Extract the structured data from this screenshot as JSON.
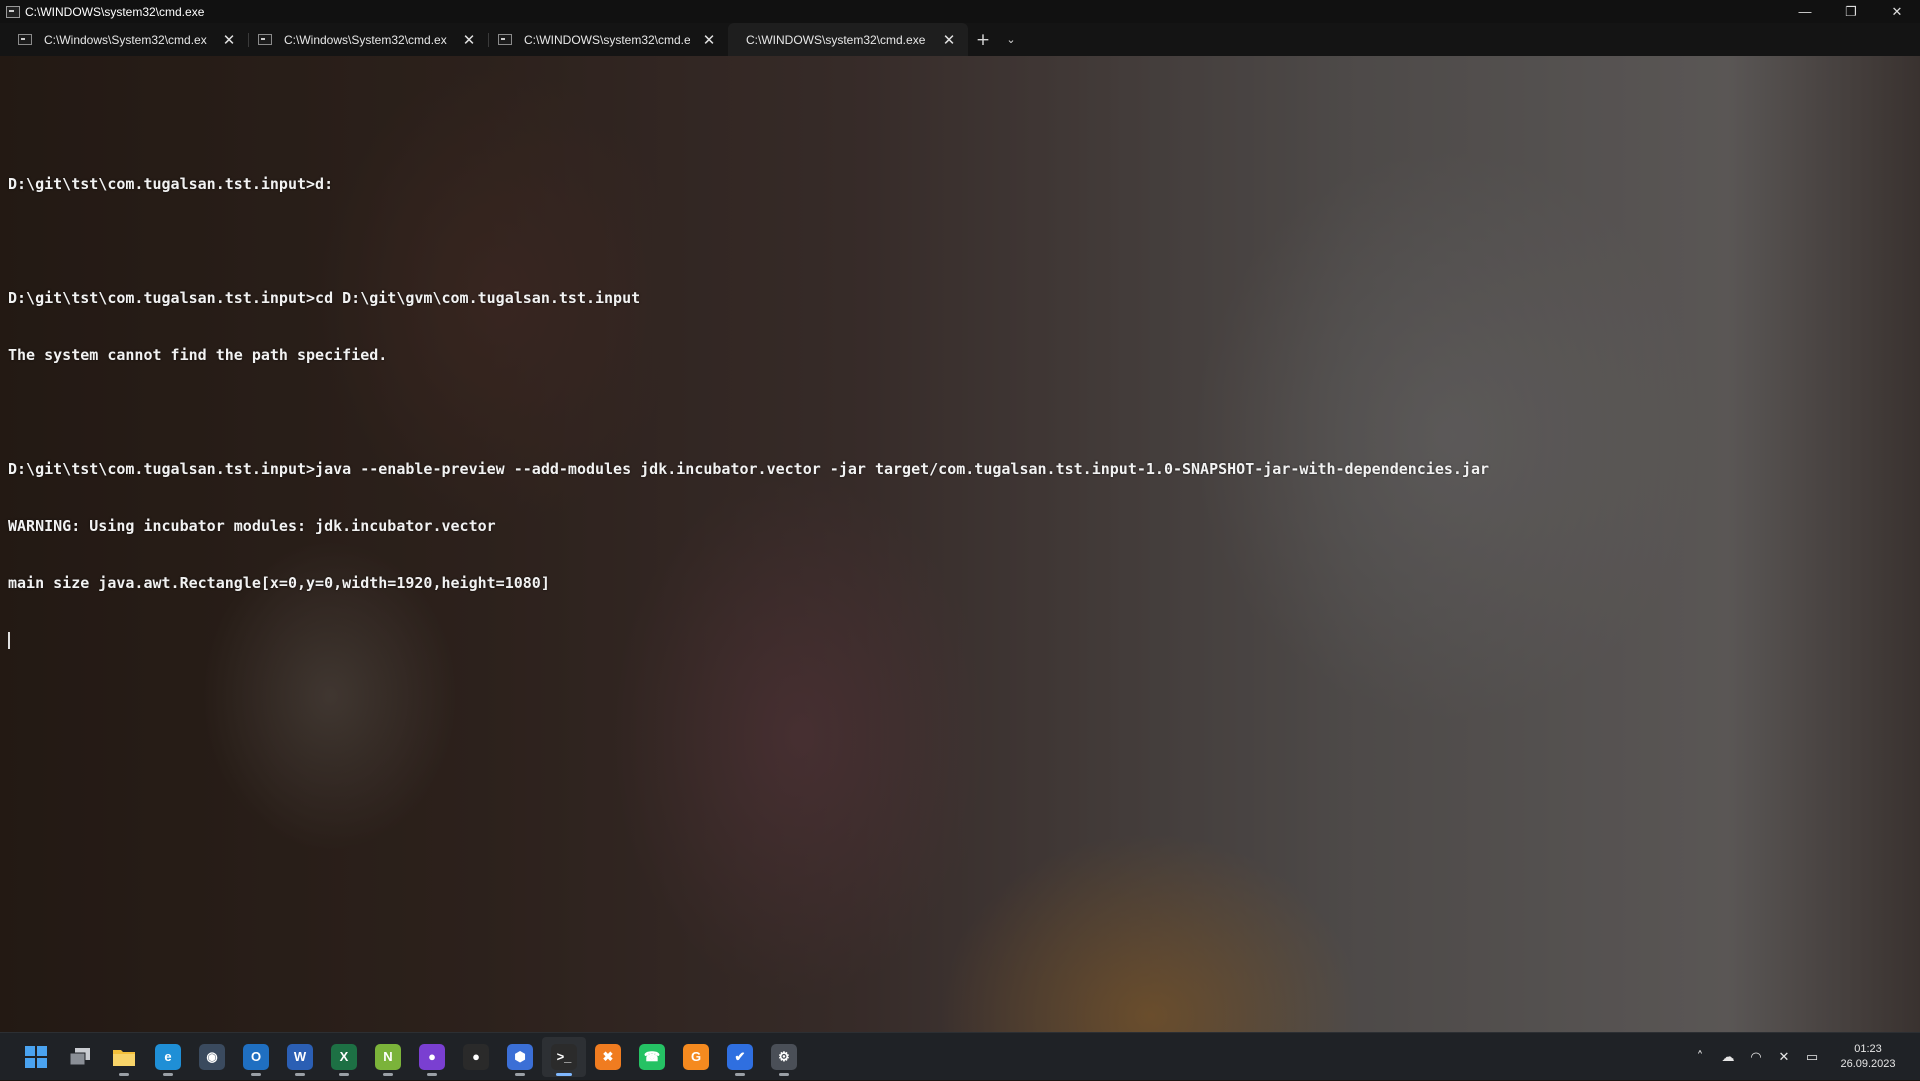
{
  "window": {
    "title": "C:\\WINDOWS\\system32\\cmd.exe",
    "controls": {
      "minimize": "—",
      "restore": "❐",
      "close": "✕"
    }
  },
  "tabs": [
    {
      "label": "C:\\Windows\\System32\\cmd.ex",
      "active": false
    },
    {
      "label": "C:\\Windows\\System32\\cmd.ex",
      "active": false
    },
    {
      "label": "C:\\WINDOWS\\system32\\cmd.е",
      "active": false
    },
    {
      "label": "C:\\WINDOWS\\system32\\cmd.exе",
      "active": true
    }
  ],
  "tab_controls": {
    "close": "✕",
    "add": "+",
    "dropdown": "⌄"
  },
  "terminal": {
    "lines": [
      "",
      "D:\\git\\tst\\com.tugalsan.tst.input>d:",
      "",
      "D:\\git\\tst\\com.tugalsan.tst.input>cd D:\\git\\gvm\\com.tugalsan.tst.input",
      "The system cannot find the path specified.",
      "",
      "D:\\git\\tst\\com.tugalsan.tst.input>java --enable-preview --add-modules jdk.incubator.vector -jar target/com.tugalsan.tst.input-1.0-SNAPSHOT-jar-with-dependencies.jar",
      "WARNING: Using incubator modules: jdk.incubator.vector",
      "main size java.awt.Rectangle[x=0,y=0,width=1920,height=1080]"
    ]
  },
  "taskbar": {
    "apps": [
      {
        "name": "start-icon",
        "glyph": "",
        "color": "#3b8eea",
        "running": false
      },
      {
        "name": "task-view-icon",
        "glyph": "",
        "color": "#8a8f96",
        "running": false
      },
      {
        "name": "file-explorer-icon",
        "glyph": "",
        "color": "#f3c03b",
        "running": true
      },
      {
        "name": "edge-icon",
        "glyph": "e",
        "color": "#1f8fd6",
        "running": true
      },
      {
        "name": "camera-app-icon",
        "glyph": "◉",
        "color": "#3a4a5e",
        "running": false
      },
      {
        "name": "outlook-icon",
        "glyph": "O",
        "color": "#1f6fc1",
        "running": true
      },
      {
        "name": "word-icon",
        "glyph": "W",
        "color": "#2b5fb4",
        "running": true
      },
      {
        "name": "excel-icon",
        "glyph": "X",
        "color": "#1d7044",
        "running": true
      },
      {
        "name": "notepad-plus-icon",
        "glyph": "N",
        "color": "#7bb33a",
        "running": true
      },
      {
        "name": "github-desktop-icon",
        "glyph": "●",
        "color": "#7a3fd1",
        "running": true
      },
      {
        "name": "github-icon",
        "glyph": "●",
        "color": "#2a2a2a",
        "running": false
      },
      {
        "name": "app-hexagon-icon",
        "glyph": "⬢",
        "color": "#3b6fd6",
        "running": true
      },
      {
        "name": "terminal-icon",
        "glyph": ">_",
        "color": "#2b2b2b",
        "running": true,
        "active": true
      },
      {
        "name": "xampp-icon",
        "glyph": "✖",
        "color": "#f07c20",
        "running": false
      },
      {
        "name": "whatsapp-icon",
        "glyph": "☎",
        "color": "#25c264",
        "running": false
      },
      {
        "name": "orange-app-icon",
        "glyph": "G",
        "color": "#f58a1f",
        "running": false
      },
      {
        "name": "todo-icon",
        "glyph": "✔",
        "color": "#2f6fe0",
        "running": true
      },
      {
        "name": "settings-icon",
        "glyph": "⚙",
        "color": "#4a4f57",
        "running": true
      }
    ],
    "tray": {
      "chevron": "˄",
      "cloud": "☁",
      "wifi": "◠",
      "volume": "✕",
      "battery": "▭"
    },
    "clock": {
      "time": "01:23",
      "date": "26.09.2023"
    }
  }
}
